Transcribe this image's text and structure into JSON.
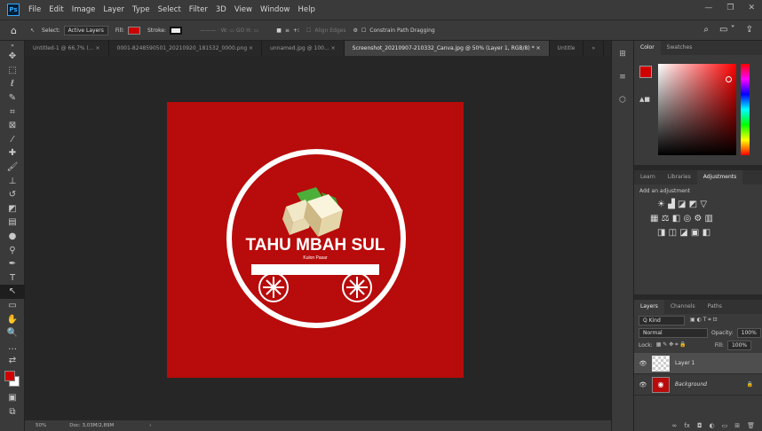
{
  "menubar": {
    "items": [
      "File",
      "Edit",
      "Image",
      "Layer",
      "Type",
      "Select",
      "Filter",
      "3D",
      "View",
      "Window",
      "Help"
    ]
  },
  "options": {
    "select_label": "Select:",
    "select_value": "Active Layers",
    "fill_label": "Fill:",
    "stroke_label": "Stroke:",
    "fill_color": "#cc0000",
    "align_edges": "Align Edges",
    "constrain": "Constrain Path Dragging"
  },
  "tabs": [
    {
      "label": "Untitled-1 @ 66,7% (...  ×"
    },
    {
      "label": "0001-8248590501_20210920_181532_0000.png  ×"
    },
    {
      "label": "unnamed.jpg @ 100...  ×"
    },
    {
      "label": "Screenshot_20210907-210332_Canva.jpg @ 50% (Layer 1, RGB/8) *  ×"
    },
    {
      "label": "Untitle"
    }
  ],
  "artwork": {
    "title": "TAHU MBAH SUL",
    "subtitle": "Kulon Pasar",
    "bg_color": "#b80b0b"
  },
  "status": {
    "zoom": "50%",
    "doc": "Doc: 3,03M/2,89M"
  },
  "color_panel": {
    "tabs": [
      "Color",
      "Swatches"
    ],
    "fg_color": "#cc0000"
  },
  "adjust_panel": {
    "tabs": [
      "Learn",
      "Libraries",
      "Adjustments"
    ],
    "add_label": "Add an adjustment"
  },
  "layers_panel": {
    "tabs": [
      "Layers",
      "Channels",
      "Paths"
    ],
    "kind": "Q Kind",
    "blend": "Normal",
    "opacity_label": "Opacity:",
    "opacity": "100%",
    "lock_label": "Lock:",
    "fill_label": "Fill:",
    "fill": "100%",
    "layers": [
      {
        "name": "Layer 1"
      },
      {
        "name": "Background"
      }
    ]
  }
}
